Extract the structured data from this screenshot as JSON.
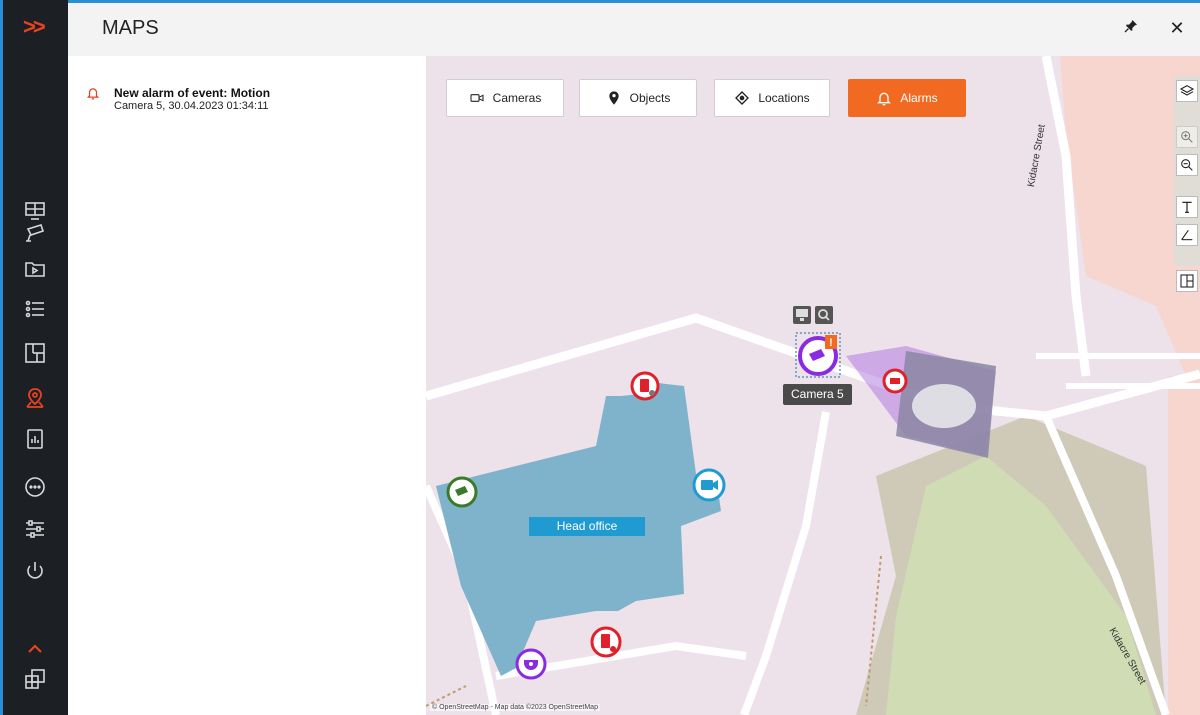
{
  "window": {
    "title": "MAPS"
  },
  "topbar": {
    "pin_icon": "pin-icon",
    "close_icon": "close-icon",
    "close_glyph": "✕"
  },
  "sidebar": {
    "expand_glyph": ">>",
    "items": [
      {
        "icon": "monitor-layout-icon"
      },
      {
        "icon": "camera-icon"
      },
      {
        "icon": "archive-play-icon"
      },
      {
        "icon": "event-list-icon"
      },
      {
        "icon": "floor-plan-icon"
      },
      {
        "icon": "map-pin-icon",
        "active": true
      },
      {
        "icon": "report-icon"
      },
      {
        "icon": "more-icon"
      },
      {
        "icon": "settings-sliders-icon"
      },
      {
        "icon": "power-icon"
      }
    ],
    "collapse_icon": "chevron-up-icon",
    "bottom_icon": "windows-icon",
    "accent_color": "#e8431f"
  },
  "alarms": [
    {
      "title": "New alarm of event: Motion",
      "detail": "Camera 5, 30.04.2023 01:34:11"
    }
  ],
  "map": {
    "filters": [
      {
        "label": "Cameras",
        "icon": "camera-icon"
      },
      {
        "label": "Objects",
        "icon": "map-pin-icon"
      },
      {
        "label": "Locations",
        "icon": "location-target-icon"
      },
      {
        "label": "Alarms",
        "icon": "bell-icon",
        "active": true
      }
    ],
    "tools": [
      "layers-icon",
      "zoom-in-icon",
      "zoom-out-icon",
      "text-tool-icon",
      "angle-tool-icon",
      "layout-icon"
    ],
    "office_label": "Head office",
    "camera_label": "Camera 5",
    "streets": [
      "Kidacre Street",
      "Kidacre Street"
    ],
    "attribution": "© OpenStreetMap - Map data ©2023 OpenStreetMap",
    "colors": {
      "alarm": "#f26a21",
      "building": "#7fb3cc",
      "camera_active": "#8a2be2",
      "park": "#cfdcb4",
      "residential": "#f7d6d0"
    }
  }
}
